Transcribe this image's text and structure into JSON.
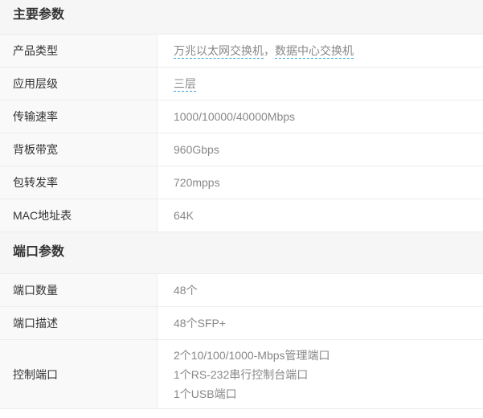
{
  "sections": [
    {
      "title": "主要参数",
      "rows": [
        {
          "label": "产品类型",
          "links": [
            "万兆以太网交换机",
            "数据中心交换机"
          ],
          "separator": "，"
        },
        {
          "label": "应用层级",
          "links": [
            "三层"
          ]
        },
        {
          "label": "传输速率",
          "value": "1000/10000/40000Mbps"
        },
        {
          "label": "背板带宽",
          "value": "960Gbps"
        },
        {
          "label": "包转发率",
          "value": "720mpps"
        },
        {
          "label": "MAC地址表",
          "value": "64K"
        }
      ]
    },
    {
      "title": "端口参数",
      "rows": [
        {
          "label": "端口数量",
          "value": "48个"
        },
        {
          "label": "端口描述",
          "value": "48个SFP+"
        },
        {
          "label": "控制端口",
          "lines": [
            "2个10/100/1000-Mbps管理端口",
            "1个RS-232串行控制台端口",
            "1个USB端口"
          ]
        }
      ]
    }
  ],
  "colors": {
    "link_underline": "#3aa0d8",
    "label_text": "#333333",
    "value_text": "#888888",
    "header_bg": "#f6f6f6"
  }
}
